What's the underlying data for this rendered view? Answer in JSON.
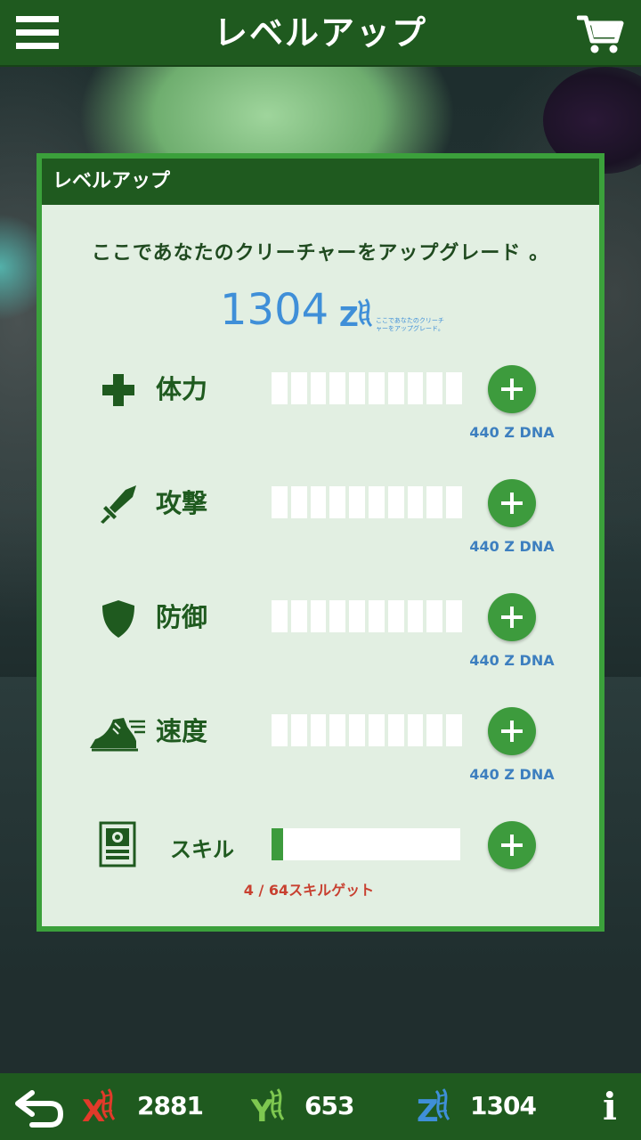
{
  "header": {
    "title": "レベルアップ"
  },
  "panel": {
    "title": "レベルアップ",
    "description": "ここであなたのクリーチャーをアップグレード 。",
    "dna_total": "1304",
    "dna_icon_caption": "ここであなたのクリーチャーをアップグレード。"
  },
  "stats": [
    {
      "label": "体力",
      "icon": "health-cross-icon",
      "filled": 0,
      "segments": 10,
      "cost": "440 Z DNA"
    },
    {
      "label": "攻撃",
      "icon": "sword-icon",
      "filled": 0,
      "segments": 10,
      "cost": "440 Z DNA"
    },
    {
      "label": "防御",
      "icon": "shield-icon",
      "filled": 0,
      "segments": 10,
      "cost": "440 Z DNA"
    },
    {
      "label": "速度",
      "icon": "running-shoe-icon",
      "filled": 0,
      "segments": 10,
      "cost": "440 Z DNA"
    }
  ],
  "skill": {
    "label": "スキル",
    "icon": "skill-card-icon",
    "progress": 0.0625,
    "note": "4 / 64スキルゲット"
  },
  "resources": {
    "x_dna": "2881",
    "y_dna": "653",
    "z_dna": "1304"
  },
  "colors": {
    "bar_green": "#1f5a1f",
    "panel_border": "#3ba03b",
    "plus_button": "#3d9b3d",
    "dna_blue": "#3f8fd8",
    "x_red": "#e23a2a",
    "y_green": "#7ec850",
    "z_blue": "#3f8fd8",
    "skill_note_red": "#c84030"
  }
}
